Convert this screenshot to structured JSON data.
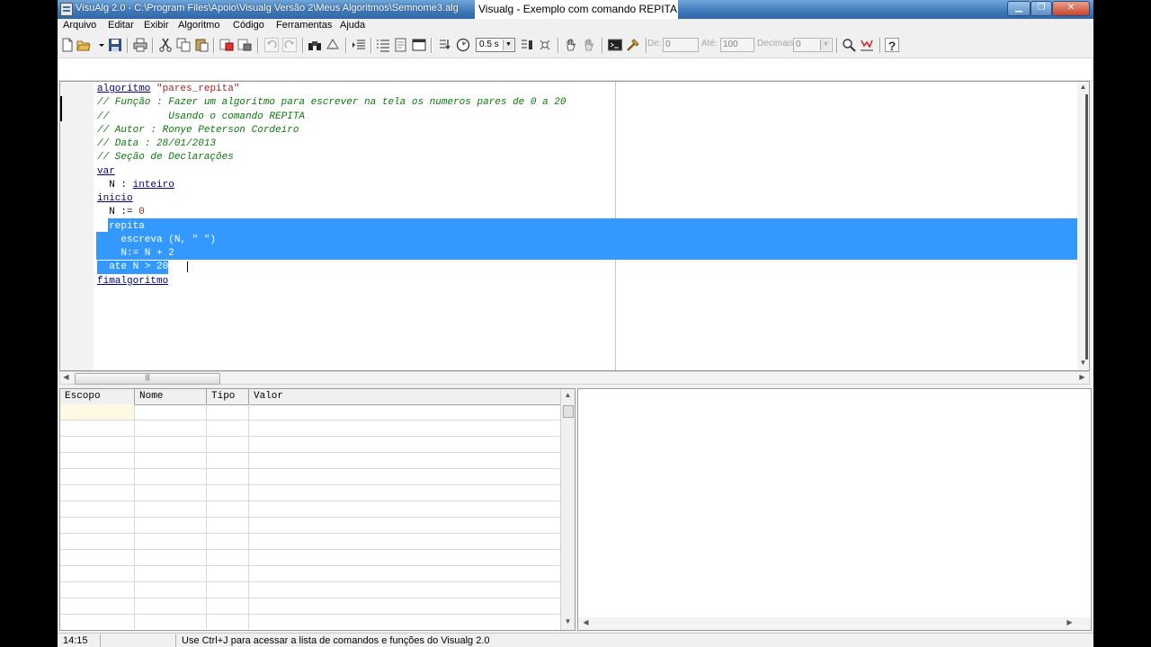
{
  "window": {
    "title_path": "VisuAlg 2.0 - C:\\Program Files\\Apoio\\Visualg Versão 2\\Meus Algoritmos\\Semnome3.alg",
    "title_tab": "Visualg - Exemplo com comando REPITA",
    "min_label": "▁",
    "max_label": "❐",
    "close_label": "✕"
  },
  "menu": [
    "Arquivo",
    "Editar",
    "Exibir",
    "Algoritmo",
    "Código",
    "Ferramentas",
    "Ajuda"
  ],
  "toolbar": {
    "speed_value": "0.5 s",
    "de_label": "De:",
    "de_value": "0",
    "ate_label": "Até:",
    "ate_value": "100",
    "decimais_label": "Decimais:",
    "decimais_value": "0",
    "help_glyph": "?"
  },
  "code": {
    "l1_kw": "algoritmo",
    "l1_str": "\"pares_repita\"",
    "l2": "// Função : Fazer um algoritmo para escrever na tela os numeros pares de 0 a 20",
    "l3": "//          Usando o comando REPITA",
    "l4": "// Autor : Ronye Peterson Cordeiro",
    "l5": "// Data : 28/01/2013",
    "l6": "// Seção de Declarações",
    "l7_kw": "var",
    "l8_pre": "  N : ",
    "l8_kw": "inteiro",
    "l9_kw": "inicio",
    "l10_pre": "  N := ",
    "l10_num": "0",
    "l11": "  repita",
    "l12": "    escreva (N, \" \")",
    "l13": "    N:= N + 2",
    "l14": "  ate N > 20",
    "l15_kw": "fimalgoritmo"
  },
  "variables_grid": {
    "columns": [
      "Escopo",
      "Nome",
      "Tipo",
      "Valor"
    ],
    "rows": []
  },
  "status": {
    "cursor_pos": "14:15",
    "panel2": "",
    "hint": "Use Ctrl+J para acessar a lista de comandos e funções do Visualg 2.0"
  },
  "icons": [
    "new-file-icon",
    "open-folder-icon",
    "save-icon",
    "print-icon",
    "cut-icon",
    "copy-icon",
    "paste-icon",
    "run-icon",
    "undo-icon",
    "redo-icon",
    "find-icon",
    "indent-icon",
    "list-icon",
    "step-icon",
    "watch-icon",
    "timer-icon",
    "hand-icon",
    "stop-icon",
    "terminal-icon",
    "tools-icon",
    "zoom-icon",
    "chart-icon",
    "help-icon"
  ]
}
